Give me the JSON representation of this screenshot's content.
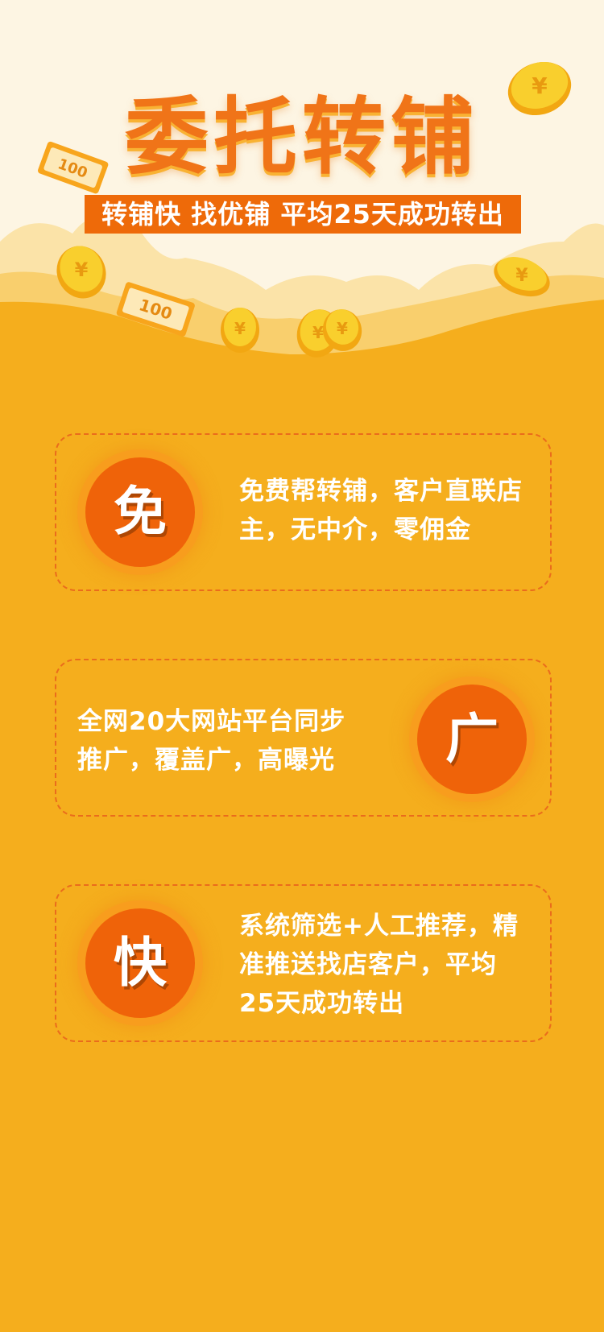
{
  "header": {
    "title": "委托转铺",
    "subtitle": "转铺快 找优铺 平均25天成功转出",
    "bill_label": "100"
  },
  "features": [
    {
      "badge": "免",
      "text": "免费帮转铺，客户直联店主，无中介，零佣金"
    },
    {
      "badge": "广",
      "text": "全网20大网站平台同步推广，覆盖广，高曝光"
    },
    {
      "badge": "快",
      "text": "系统筛选+人工推荐，精准推送找店客户，平均25天成功转出"
    }
  ],
  "colors": {
    "page_background": "#f5ae1d",
    "hero_background": "#fdf5e3",
    "accent_orange": "#ef6309",
    "title_orange": "#f07418",
    "coin_gold": "#f7c21a"
  },
  "decorations": [
    "coin-icon",
    "banknote-icon"
  ]
}
